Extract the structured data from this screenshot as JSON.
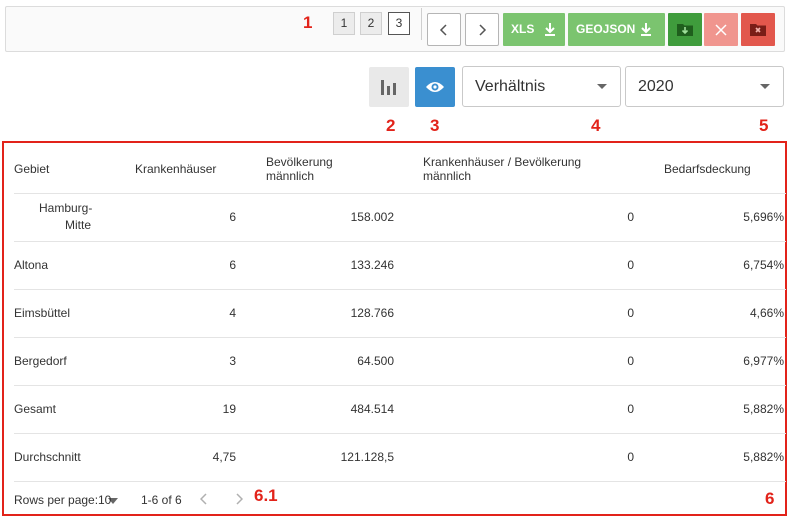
{
  "annotations": {
    "a1": "1",
    "a2": "2",
    "a3": "3",
    "a4": "4",
    "a5": "5",
    "a6": "6",
    "a61": "6.1"
  },
  "toolbar": {
    "pages": [
      "1",
      "2",
      "3"
    ],
    "active_page": "3",
    "prev_icon": "chevron-left-icon",
    "next_icon": "chevron-right-icon",
    "xls_label": "XLS",
    "geojson_label": "GEOJSON",
    "download_icon": "download-icon",
    "save_icon": "folder-download-icon",
    "close_icon": "close-icon",
    "delete_icon": "folder-delete-icon",
    "colors": {
      "green": "#7bc46f",
      "dark_green": "#3f9c3c",
      "light_red": "#f0958e",
      "red": "#e2574c"
    }
  },
  "controls": {
    "chart_icon": "bar-chart-icon",
    "eye_icon": "eye-icon",
    "eye_color": "#3a8fd0",
    "measure_select": "Verhältnis",
    "year_select": "2020"
  },
  "table": {
    "headers": [
      {
        "line1": "Gebiet",
        "line2": ""
      },
      {
        "line1": "Krankenhäuser",
        "line2": ""
      },
      {
        "line1": "Bevölkerung",
        "line2": "männlich"
      },
      {
        "line1": "Krankenhäuser / Bevölkerung",
        "line2": "männlich"
      },
      {
        "line1": "Bedarfsdeckung",
        "line2": ""
      }
    ],
    "rows": [
      {
        "gebiet": "Hamburg-Mitte",
        "gebiet_l1": "Hamburg-",
        "gebiet_l2": "Mitte",
        "krankenhaeuser": "6",
        "bevoelkerung": "158.002",
        "verhaeltnis": "0",
        "bedarf": "5,696%"
      },
      {
        "gebiet": "Altona",
        "krankenhaeuser": "6",
        "bevoelkerung": "133.246",
        "verhaeltnis": "0",
        "bedarf": "6,754%"
      },
      {
        "gebiet": "Eimsbüttel",
        "krankenhaeuser": "4",
        "bevoelkerung": "128.766",
        "verhaeltnis": "0",
        "bedarf": "4,66%"
      },
      {
        "gebiet": "Bergedorf",
        "krankenhaeuser": "3",
        "bevoelkerung": "64.500",
        "verhaeltnis": "0",
        "bedarf": "6,977%"
      },
      {
        "gebiet": "Gesamt",
        "krankenhaeuser": "19",
        "bevoelkerung": "484.514",
        "verhaeltnis": "0",
        "bedarf": "5,882%"
      },
      {
        "gebiet": "Durchschnitt",
        "krankenhaeuser": "4,75",
        "bevoelkerung": "121.128,5",
        "verhaeltnis": "0",
        "bedarf": "5,882%"
      }
    ]
  },
  "footer": {
    "rows_per_page_label": "Rows per page:",
    "rows_per_page_value": "10",
    "range_text": "1-6 of 6",
    "prev_icon": "chevron-left-icon",
    "next_icon": "chevron-right-icon"
  }
}
